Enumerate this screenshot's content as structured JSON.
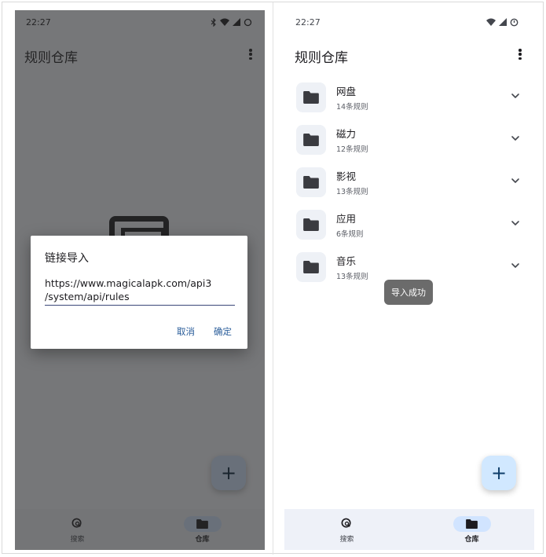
{
  "left_screen": {
    "status": {
      "time": "22:27"
    },
    "app_bar": {
      "title": "规则仓库"
    },
    "dialog": {
      "title": "链接导入",
      "input_value": "https://www.magicalapk.com/api3\n/system/api/rules",
      "cancel_label": "取消",
      "confirm_label": "确定"
    },
    "fab": {
      "label": "+",
      "icon": "plus-icon"
    },
    "bottom_nav": [
      {
        "label": "搜索",
        "icon": "search-rule-icon",
        "active": false
      },
      {
        "label": "仓库",
        "icon": "folder-icon",
        "active": true
      }
    ]
  },
  "right_screen": {
    "status": {
      "time": "22:27"
    },
    "app_bar": {
      "title": "规则仓库"
    },
    "repos": [
      {
        "name": "网盘",
        "count": "14条规则"
      },
      {
        "name": "磁力",
        "count": "12条规则"
      },
      {
        "name": "影视",
        "count": "13条规则"
      },
      {
        "name": "应用",
        "count": "6条规则"
      },
      {
        "name": "音乐",
        "count": "13条规则"
      }
    ],
    "toast": "导入成功",
    "fab": {
      "label": "+",
      "icon": "plus-icon"
    },
    "bottom_nav": [
      {
        "label": "搜索",
        "icon": "search-rule-icon",
        "active": false
      },
      {
        "label": "仓库",
        "icon": "folder-icon",
        "active": true
      }
    ]
  },
  "colors": {
    "accent_pill": "#d1e4ff",
    "dialog_button": "#2a5d9a",
    "toast_bg": "#6b6b6b"
  }
}
